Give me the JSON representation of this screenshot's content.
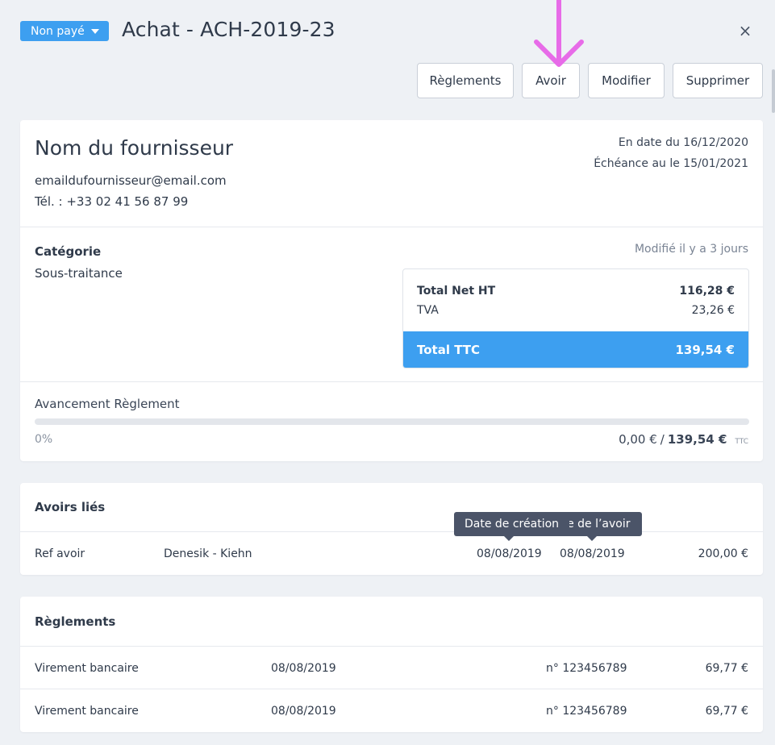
{
  "header": {
    "status_label": "Non payé",
    "title": "Achat -  ACH-2019-23",
    "close_icon": "close-icon",
    "close_glyph": "×"
  },
  "toolbar": {
    "reglements_label": "Règlements",
    "avoir_label": "Avoir",
    "modifier_label": "Modifier",
    "supprimer_label": "Supprimer"
  },
  "supplier": {
    "name": "Nom du fournisseur",
    "email": "emaildufournisseur@email.com",
    "phone": "Tél. : +33 02 41 56 87 99",
    "date": "En date du 16/12/2020",
    "due": "Échéance au le 15/01/2021"
  },
  "details": {
    "category_label": "Catégorie",
    "category_value": "Sous-traitance",
    "modified": "Modifié il y a 3 jours",
    "totals": {
      "net_ht_label": "Total Net HT",
      "net_ht_value": "116,28 €",
      "tva_label": "TVA",
      "tva_value": "23,26 €",
      "ttc_label": "Total TTC",
      "ttc_value": "139,54 €"
    }
  },
  "progress": {
    "label": "Avancement Règlement",
    "percent_text": "0%",
    "fraction": 0,
    "paid": "0,00 €",
    "separator": " / ",
    "total": "139,54 €",
    "unit": "TTC"
  },
  "avoirs": {
    "title": "Avoirs liés",
    "row": {
      "ref": "Ref avoir",
      "client": "Denesik - Kiehn",
      "date_creation": "08/08/2019",
      "date_avoir": "08/08/2019",
      "amount": "200,00 €"
    },
    "tooltip_creation": "Date de création",
    "tooltip_avoir": "ate de l’avoir"
  },
  "reglements": {
    "title": "Règlements",
    "rows": [
      {
        "method": "Virement bancaire",
        "date": "08/08/2019",
        "ref": "n° 123456789",
        "amount": "69,77 €"
      },
      {
        "method": "Virement bancaire",
        "date": "08/08/2019",
        "ref": "n° 123456789",
        "amount": "69,77 €"
      }
    ]
  },
  "colors": {
    "accent": "#3d9ff0",
    "annotation_arrow": "#e76be8",
    "tooltip_bg": "#4b5468",
    "background": "#eef1f5"
  }
}
